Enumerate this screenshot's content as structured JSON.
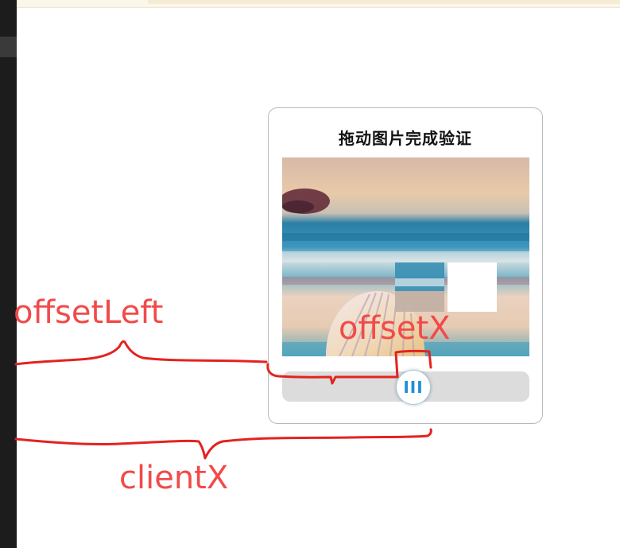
{
  "captcha": {
    "title": "拖动图片完成验证",
    "slider_glyph": "III",
    "slider_progress": 0.47
  },
  "annotations": {
    "offset_left": "offsetLeft",
    "offset_x": "offsetX",
    "client_x": "clientX"
  },
  "colors": {
    "annotation": "#f24a4a",
    "handle_accent": "#1f8fd6",
    "track": "#dcdcdc"
  },
  "icons": {
    "slider_handle": "grip-bars-icon",
    "puzzle_piece": "puzzle-piece-icon",
    "puzzle_target": "puzzle-slot-icon"
  }
}
